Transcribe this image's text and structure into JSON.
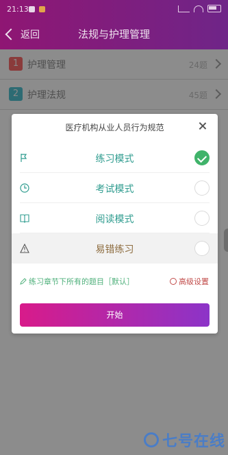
{
  "status_bar": {
    "time": "21:13"
  },
  "header": {
    "back_label": "返回",
    "title": "法规与护理管理"
  },
  "list": [
    {
      "number": "1",
      "label": "护理管理",
      "count": "24题",
      "number_color": "#8a3b3b"
    },
    {
      "number": "2",
      "label": "护理法规",
      "count": "45题",
      "number_color": "#2d6b73"
    }
  ],
  "modal": {
    "title": "医疗机构从业人员行为规范",
    "options": [
      {
        "label": "练习模式",
        "icon": "flag-icon",
        "color": "#2f9c8f",
        "selected": true
      },
      {
        "label": "考试模式",
        "icon": "clock-icon",
        "color": "#2f9c8f",
        "selected": false
      },
      {
        "label": "阅读模式",
        "icon": "book-icon",
        "color": "#2f9c8f",
        "selected": false
      },
      {
        "label": "易错练习",
        "icon": "warning-icon",
        "color": "#8d6c3f",
        "selected": false
      }
    ],
    "note": "练习章节下所有的题目［默认］",
    "advanced": "高级设置",
    "start_button": "开始"
  },
  "watermark": {
    "text": "七号在线"
  },
  "colors": {
    "accent_gradient_start": "#d81b8a",
    "accent_gradient_end": "#8c34c8",
    "selected_green": "#40b36a",
    "note_green": "#4fb07b",
    "advanced_red": "#c14b49"
  }
}
